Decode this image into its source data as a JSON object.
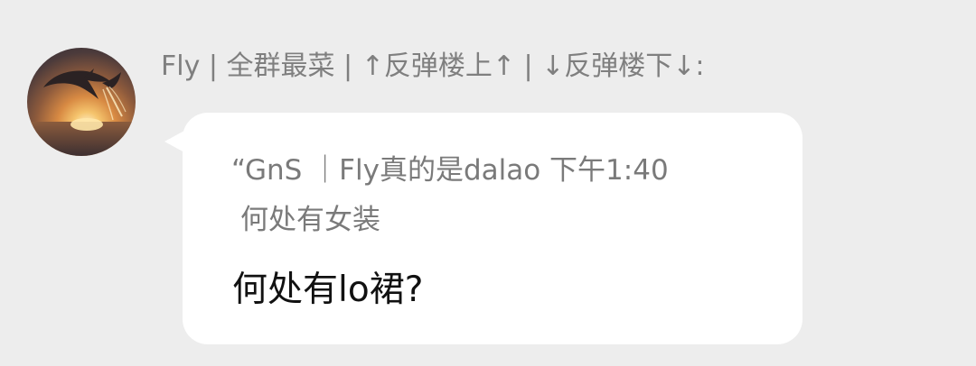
{
  "message": {
    "sender_label": "Fly | 全群最菜 | ↑反弹楼上↑ | ↓反弹楼下↓:",
    "quote_line1": "“GnS ｜Fly真的是dalao 下午1:40",
    "quote_line2": "何处有女装",
    "text": "何处有lo裙?"
  },
  "avatar": {
    "icon": "dolphin-sunset-avatar"
  },
  "colors": {
    "background": "#ededed",
    "bubble": "#ffffff",
    "quote_text": "#7a7a7a",
    "message_text": "#111111"
  }
}
